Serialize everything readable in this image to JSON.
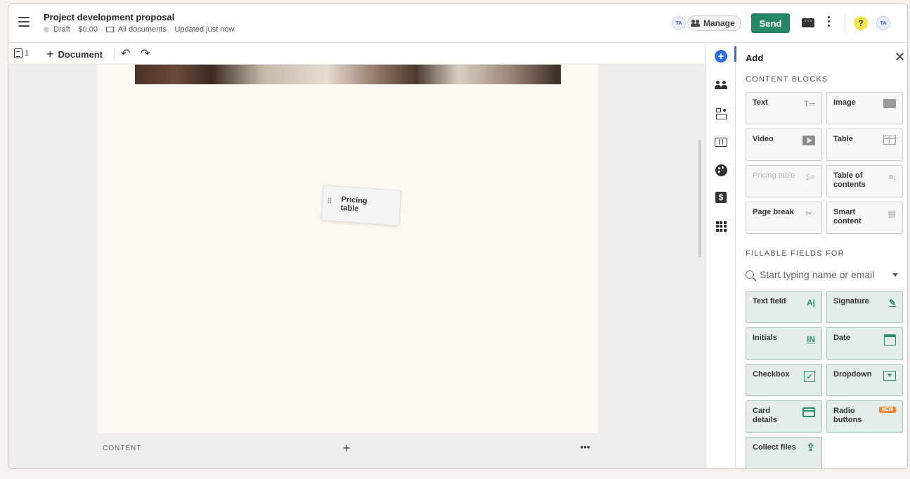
{
  "header": {
    "title": "Project development proposal",
    "status": "Draft",
    "amount": "$0.00",
    "folder": "All documents",
    "updated": "Updated just now",
    "avatar_left": "TA",
    "manage_label": "Manage",
    "send_label": "Send",
    "help_label": "?",
    "avatar_right": "TA"
  },
  "toolbar": {
    "page_count": "1",
    "add_document_label": "Document"
  },
  "canvas": {
    "drag_block_label": "Pricing table",
    "content_label": "CONTENT"
  },
  "panel": {
    "title": "Add",
    "content_blocks_heading": "CONTENT BLOCKS",
    "content_blocks": [
      {
        "label": "Text",
        "icon": "text-icon"
      },
      {
        "label": "Image",
        "icon": "image-icon"
      },
      {
        "label": "Video",
        "icon": "video-icon"
      },
      {
        "label": "Table",
        "icon": "table-icon"
      },
      {
        "label": "Pricing table",
        "icon": "pricing-table-icon",
        "disabled": true
      },
      {
        "label": "Table of contents",
        "icon": "table-of-contents-icon"
      },
      {
        "label": "Page break",
        "icon": "scissors-icon"
      },
      {
        "label": "Smart content",
        "icon": "smart-content-icon"
      }
    ],
    "fillable_heading": "FILLABLE FIELDS FOR",
    "search_placeholder": "Start typing name or email",
    "fields": [
      {
        "label": "Text field",
        "icon": "text-field-icon"
      },
      {
        "label": "Signature",
        "icon": "signature-icon"
      },
      {
        "label": "Initials",
        "icon": "initials-icon"
      },
      {
        "label": "Date",
        "icon": "calendar-icon"
      },
      {
        "label": "Checkbox",
        "icon": "checkbox-icon"
      },
      {
        "label": "Dropdown",
        "icon": "dropdown-icon"
      },
      {
        "label": "Card details",
        "icon": "card-icon"
      },
      {
        "label": "Radio buttons",
        "icon": "radio-icon",
        "badge": "NEW"
      },
      {
        "label": "Collect files",
        "icon": "upload-icon"
      }
    ],
    "icon_glyphs": {
      "text": "T═",
      "pricing": "$≡",
      "toc": "≡:",
      "scissors": "✂·",
      "smart": "▤",
      "text_field": "A|",
      "signature": "✎",
      "initials": "IN",
      "checkbox": "✓",
      "upload": "⇪"
    }
  }
}
